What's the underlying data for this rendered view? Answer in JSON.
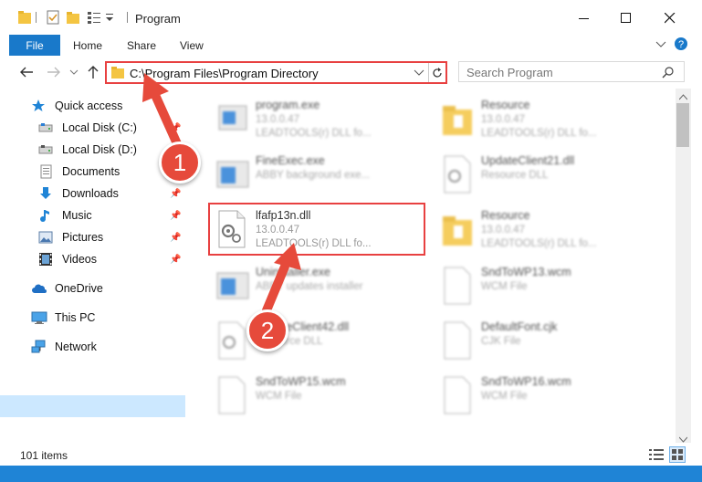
{
  "window": {
    "title": "Program",
    "minimize_label": "—",
    "maximize_label": "☐",
    "close_label": "✕"
  },
  "ribbon": {
    "tabs": [
      "File",
      "Home",
      "Share",
      "View"
    ]
  },
  "address": {
    "path": "C:\\Program Files\\Program Directory",
    "search_placeholder": "Search Program"
  },
  "sidebar": {
    "items": [
      {
        "label": "Quick access",
        "icon": "star-icon"
      },
      {
        "label": "Local Disk (C:)",
        "icon": "drive-icon"
      },
      {
        "label": "Local Disk (D:)",
        "icon": "drive-icon"
      },
      {
        "label": "Documents",
        "icon": "documents-icon"
      },
      {
        "label": "Downloads",
        "icon": "download-arrow-icon"
      },
      {
        "label": "Music",
        "icon": "music-note-icon"
      },
      {
        "label": "Pictures",
        "icon": "pictures-icon"
      },
      {
        "label": "Videos",
        "icon": "film-icon"
      },
      {
        "label": "OneDrive",
        "icon": "cloud-icon"
      },
      {
        "label": "This PC",
        "icon": "monitor-icon"
      },
      {
        "label": "Network",
        "icon": "network-icon"
      }
    ]
  },
  "files": [
    {
      "name": "program.exe",
      "version": "13.0.0.47",
      "desc": "LEADTOOLS(r) DLL fo..."
    },
    {
      "name": "Resource",
      "version": "13.0.0.47",
      "desc": "LEADTOOLS(r) DLL fo..."
    },
    {
      "name": "FineExec.exe",
      "version": "",
      "desc": "ABBY background exe..."
    },
    {
      "name": "UpdateClient21.dll",
      "version": "",
      "desc": "Resource DLL"
    },
    {
      "name": "lfafp13n.dll",
      "version": "13.0.0.47",
      "desc": "LEADTOOLS(r) DLL fo..."
    },
    {
      "name": "Resource",
      "version": "13.0.0.47",
      "desc": "LEADTOOLS(r) DLL fo..."
    },
    {
      "name": "Uninstaller.exe",
      "version": "",
      "desc": "ABBY updates installer"
    },
    {
      "name": "SndToWP13.wcm",
      "version": "",
      "desc": "WCM File"
    },
    {
      "name": "UpdateClient42.dll",
      "version": "",
      "desc": "Resource DLL"
    },
    {
      "name": "DefaultFont.cjk",
      "version": "",
      "desc": "CJK File"
    },
    {
      "name": "SndToWP15.wcm",
      "version": "",
      "desc": "WCM File"
    },
    {
      "name": "SndToWP16.wcm",
      "version": "",
      "desc": "WCM File"
    }
  ],
  "status": {
    "item_count": "101 items"
  },
  "callouts": [
    "1",
    "2"
  ],
  "colors": {
    "accent": "#1979ca",
    "highlight": "#e84141",
    "callout": "#e64a3b",
    "selection": "#cce8ff"
  }
}
